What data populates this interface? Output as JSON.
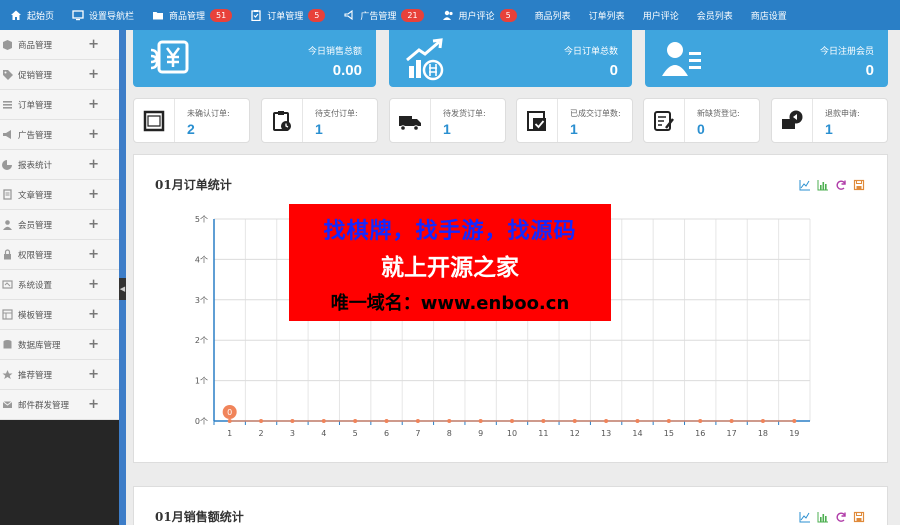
{
  "topnav": {
    "items": [
      {
        "label": "起始页",
        "icon": "home-icon"
      },
      {
        "label": "设置导航栏",
        "icon": "monitor-icon"
      },
      {
        "label": "商品管理",
        "icon": "folder-icon",
        "badge": "51"
      },
      {
        "label": "订单管理",
        "icon": "clipboard-icon",
        "badge": "5"
      },
      {
        "label": "广告管理",
        "icon": "megaphone-icon",
        "badge": "21"
      },
      {
        "label": "用户评论",
        "icon": "users-icon",
        "badge": "5"
      },
      {
        "label": "商品列表"
      },
      {
        "label": "订单列表"
      },
      {
        "label": "用户评论"
      },
      {
        "label": "会员列表"
      },
      {
        "label": "商店设置"
      }
    ]
  },
  "sidebar": {
    "items": [
      {
        "label": "商品管理",
        "icon": "box-icon"
      },
      {
        "label": "促销管理",
        "icon": "tag-icon"
      },
      {
        "label": "订单管理",
        "icon": "list-icon"
      },
      {
        "label": "广告管理",
        "icon": "megaphone-icon"
      },
      {
        "label": "报表统计",
        "icon": "pie-chart-icon"
      },
      {
        "label": "文章管理",
        "icon": "document-icon"
      },
      {
        "label": "会员管理",
        "icon": "user-icon"
      },
      {
        "label": "权限管理",
        "icon": "lock-icon"
      },
      {
        "label": "系统设置",
        "icon": "gear-icon"
      },
      {
        "label": "模板管理",
        "icon": "template-icon"
      },
      {
        "label": "数据库管理",
        "icon": "database-icon"
      },
      {
        "label": "推荐管理",
        "icon": "star-icon"
      },
      {
        "label": "邮件群发管理",
        "icon": "mail-icon"
      }
    ],
    "collapse_glyph": "◀"
  },
  "stats_big": [
    {
      "label": "今日销售总额",
      "value": "0.00",
      "icon": "money-icon"
    },
    {
      "label": "今日订单总数",
      "value": "0",
      "icon": "growth-chart-icon"
    },
    {
      "label": "今日注册会员",
      "value": "0",
      "icon": "member-card-icon"
    }
  ],
  "stats_small": [
    {
      "label": "未确认订单:",
      "value": "2",
      "icon": "square-icon"
    },
    {
      "label": "待支付订单:",
      "value": "1",
      "icon": "pay-clipboard-icon"
    },
    {
      "label": "待发货订单:",
      "value": "1",
      "icon": "truck-icon"
    },
    {
      "label": "已成交订单数:",
      "value": "1",
      "icon": "done-box-icon"
    },
    {
      "label": "新缺货登记:",
      "value": "0",
      "icon": "edit-note-icon"
    },
    {
      "label": "退款申请:",
      "value": "1",
      "icon": "refund-icon"
    }
  ],
  "colors": {
    "topnav": "#2a7fc6",
    "card": "#3fa5de",
    "value": "#2a8fd0",
    "badge": "#e8413a",
    "axis": "#2a7fc6",
    "series": "#f0845a",
    "ad_bg": "#ff0000",
    "ad_line1": "#1428ff"
  },
  "chart_panels": [
    {
      "title": "01月订单统计"
    },
    {
      "title": "01月销售额统计"
    }
  ],
  "chart_data": [
    {
      "type": "line",
      "title": "01月订单统计",
      "xlabel": "",
      "ylabel": "",
      "x": [
        1,
        2,
        3,
        4,
        5,
        6,
        7,
        8,
        9,
        10,
        11,
        12,
        13,
        14,
        15,
        16,
        17,
        18,
        19
      ],
      "y_ticks": [
        "0个",
        "1个",
        "2个",
        "3个",
        "4个",
        "5个"
      ],
      "ylim": [
        0,
        5
      ],
      "series": [
        {
          "values": [
            0,
            0,
            0,
            0,
            0,
            0,
            0,
            0,
            0,
            0,
            0,
            0,
            0,
            0,
            0,
            0,
            0,
            0,
            0
          ]
        }
      ],
      "data_labels": [
        {
          "x": 1,
          "text": "0"
        }
      ],
      "grid": true
    },
    {
      "type": "line",
      "title": "01月销售额统计",
      "grid": true
    }
  ],
  "ad": {
    "line1": "找棋牌，找手游，找源码",
    "line2": "就上开源之家",
    "line3": "唯一域名：www.enboo.cn"
  }
}
